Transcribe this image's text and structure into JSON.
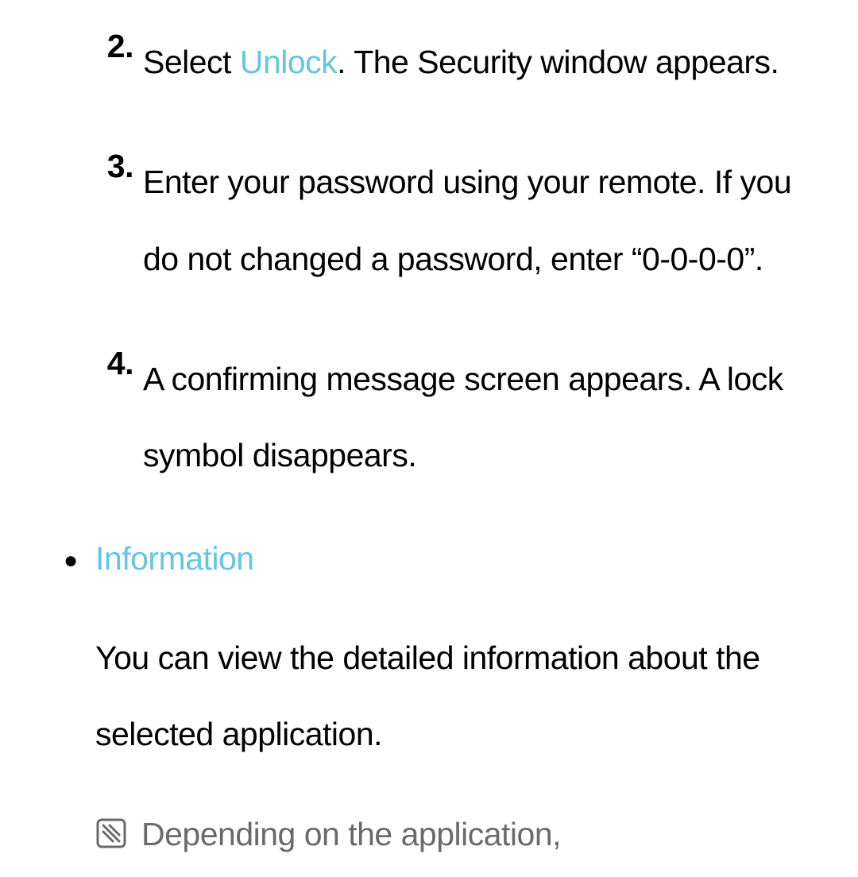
{
  "steps": {
    "item2": {
      "marker": "2.",
      "prefix": "Select ",
      "highlight": "Unlock",
      "suffix": ". The Security window appears."
    },
    "item3": {
      "marker": "3.",
      "text": "Enter your password using your remote. If you do not changed a password, enter “0-0-0-0”."
    },
    "item4": {
      "marker": "4.",
      "text": "A confirming message screen appears. A lock symbol disappears."
    }
  },
  "information": {
    "title": "Information",
    "body": "You can view the detailed information about the selected application.",
    "note": "Depending on the application,"
  }
}
